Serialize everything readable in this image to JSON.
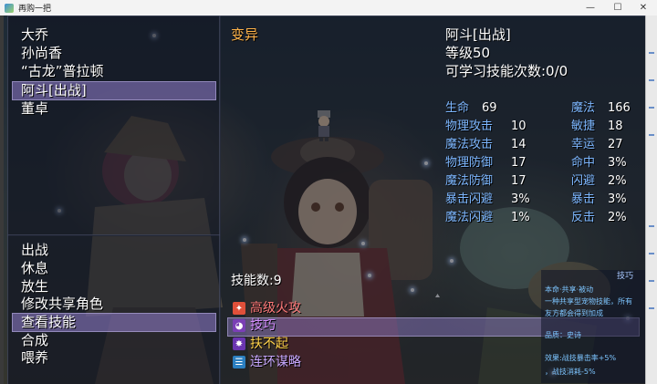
{
  "window": {
    "title": "再购一把",
    "minimize": "—",
    "maximize": "☐",
    "close": "✕"
  },
  "characters": [
    "大乔",
    "孙尚香",
    "“古龙”普拉顿",
    "阿斗[出战]",
    "董卓"
  ],
  "selected_character_index": 3,
  "commands": [
    "出战",
    "休息",
    "放生",
    "修改共享角色",
    "查看技能",
    "合成",
    "喂养"
  ],
  "selected_command_index": 4,
  "detail": {
    "mutation_label": "变异",
    "name": "阿斗[出战]",
    "level": "等级50",
    "learnable": "可学习技能次数:0/0",
    "stats_left": [
      {
        "label": "生命",
        "value": "69"
      },
      {
        "label": "物理攻击",
        "value": "10"
      },
      {
        "label": "魔法攻击",
        "value": "14"
      },
      {
        "label": "物理防御",
        "value": "17"
      },
      {
        "label": "魔法防御",
        "value": "17"
      },
      {
        "label": "暴击闪避",
        "value": "3%"
      },
      {
        "label": "魔法闪避",
        "value": "1%"
      }
    ],
    "stats_right": [
      {
        "label": "魔法",
        "value": "166"
      },
      {
        "label": "敏捷",
        "value": "18"
      },
      {
        "label": "幸运",
        "value": "27"
      },
      {
        "label": "命中",
        "value": "3%"
      },
      {
        "label": "闪避",
        "value": "2%"
      },
      {
        "label": "暴击",
        "value": "3%"
      },
      {
        "label": "反击",
        "value": "2%"
      }
    ],
    "skill_count": "技能数:9",
    "skills": [
      {
        "name": "高级火攻",
        "icon": "fire-icon",
        "color": "#ff7a7a",
        "icon_bg": "#e0503a"
      },
      {
        "name": "技巧",
        "icon": "mask-icon",
        "color": "#d58cff",
        "icon_bg": "#7a3fb5"
      },
      {
        "name": "扶不起",
        "icon": "burst-icon",
        "color": "#ffd24a",
        "icon_bg": "#6a35b0"
      },
      {
        "name": "连环谋略",
        "icon": "scroll-icon",
        "color": "#c8a8ff",
        "icon_bg": "#2b7fc0"
      }
    ],
    "selected_skill_index": 1
  },
  "skill_info": {
    "title": "技巧",
    "lines": [
      "本命·共享·被动",
      "一种共享型宠物技能，所有",
      "友方都会得到加成",
      "品质：史诗",
      "效果:战技暴击率+5%",
      "，战技消耗-5%"
    ]
  },
  "colors": {
    "label_blue": "#7db7ff",
    "accent_orange": "#ffb34a",
    "selection": "#9682d2",
    "info_text": "#7dc5ff"
  }
}
